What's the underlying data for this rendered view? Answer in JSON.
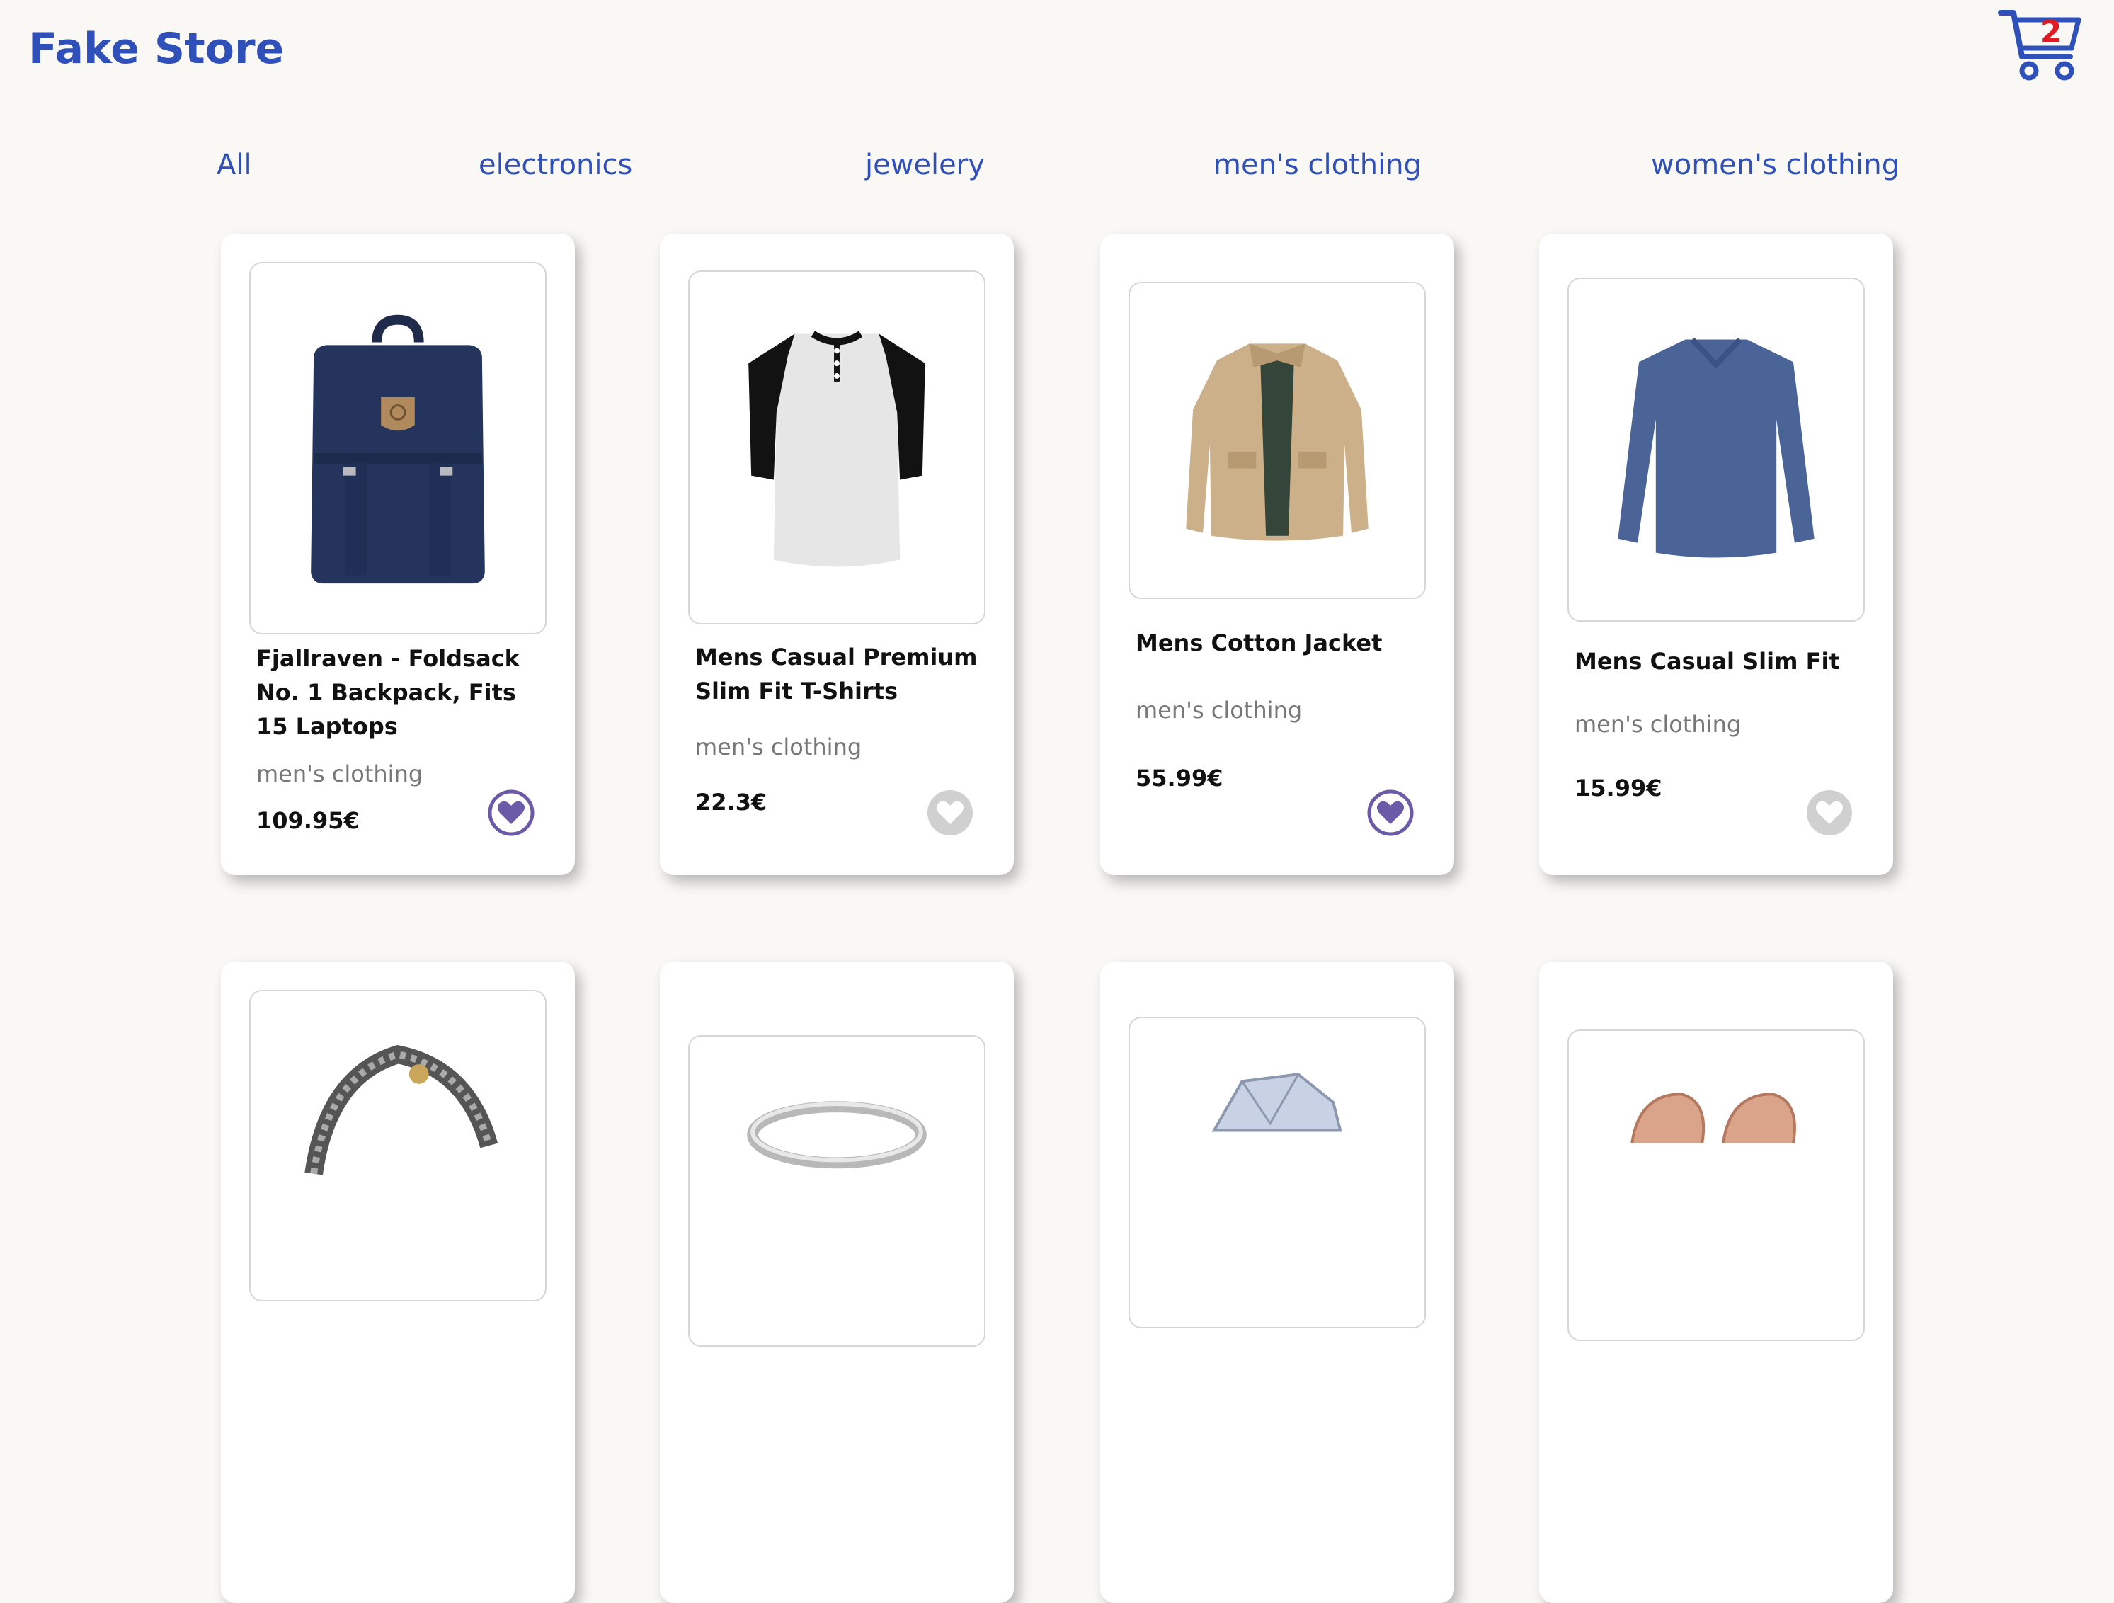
{
  "header": {
    "logo": "Fake Store",
    "cart_count": "2"
  },
  "nav": {
    "items": [
      "All",
      "electronics",
      "jewelery",
      "men's clothing",
      "women's clothing"
    ]
  },
  "products": [
    {
      "title": "Fjallraven - Foldsack No. 1 Backpack, Fits 15 Laptops",
      "category": "men's clothing",
      "price": "109.95€",
      "favorite": true,
      "image": "navy-backpack"
    },
    {
      "title": "Mens Casual Premium Slim Fit T-Shirts",
      "category": "men's clothing",
      "price": "22.3€",
      "favorite": false,
      "image": "raglan-tshirt"
    },
    {
      "title": "Mens Cotton Jacket",
      "category": "men's clothing",
      "price": "55.99€",
      "favorite": true,
      "image": "khaki-jacket"
    },
    {
      "title": "Mens Casual Slim Fit",
      "category": "men's clothing",
      "price": "15.99€",
      "favorite": false,
      "image": "blue-longsleeve"
    },
    {
      "image": "dragon-bracelet"
    },
    {
      "image": "silver-ring"
    },
    {
      "image": "diamond-ring"
    },
    {
      "image": "rose-gold-earrings"
    }
  ],
  "colors": {
    "brand": "#2e50b8",
    "heart_active": "#6a5aa8",
    "heart_inactive": "#d0d0d0",
    "cart_badge": "#e01b24"
  }
}
